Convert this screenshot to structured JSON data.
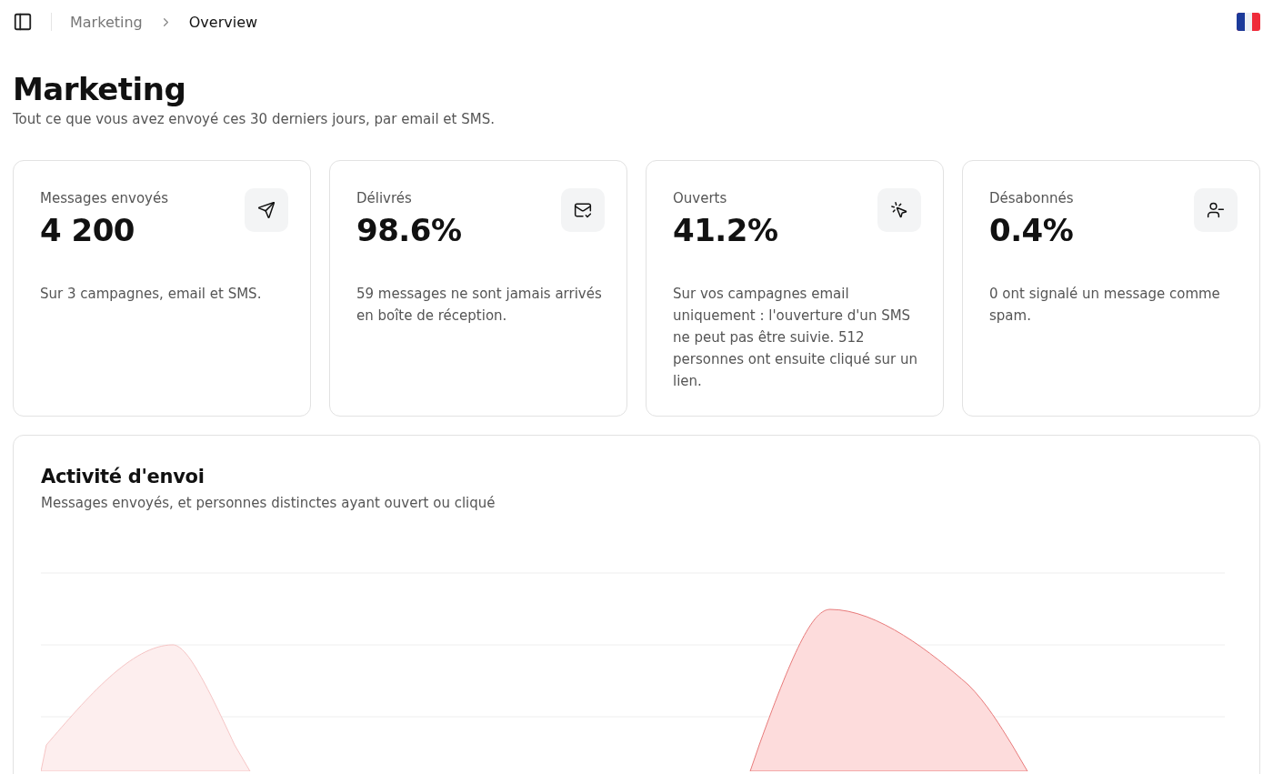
{
  "breadcrumb": [
    {
      "label": "Marketing",
      "selected": false
    },
    {
      "label": "Overview",
      "selected": true
    }
  ],
  "page": {
    "title": "Marketing",
    "subtitle": "Tout ce que vous avez envoyé ces 30 derniers jours, par email et SMS."
  },
  "stats": [
    {
      "kind": "sent",
      "label": "Messages envoyés",
      "value": "4 200",
      "note": "Sur 3 campagnes, email et SMS."
    },
    {
      "kind": "delivered",
      "label": "Délivrés",
      "value": "98.6%",
      "note": "59 messages ne sont jamais arrivés en boîte de réception."
    },
    {
      "kind": "opened",
      "label": "Ouverts",
      "value": "41.2%",
      "note": "Sur vos campagnes email uniquement : l'ouverture d'un SMS ne peut pas être suivie. 512 personnes ont ensuite cliqué sur un lien."
    },
    {
      "kind": "unsubscribed",
      "label": "Désabonnés",
      "value": "0.4%",
      "note": "0 ont signalé un message comme spam."
    }
  ],
  "activity": {
    "title": "Activité d'envoi",
    "subtitle": "Messages envoyés, et personnes distinctes ayant ouvert ou cliqué"
  }
}
